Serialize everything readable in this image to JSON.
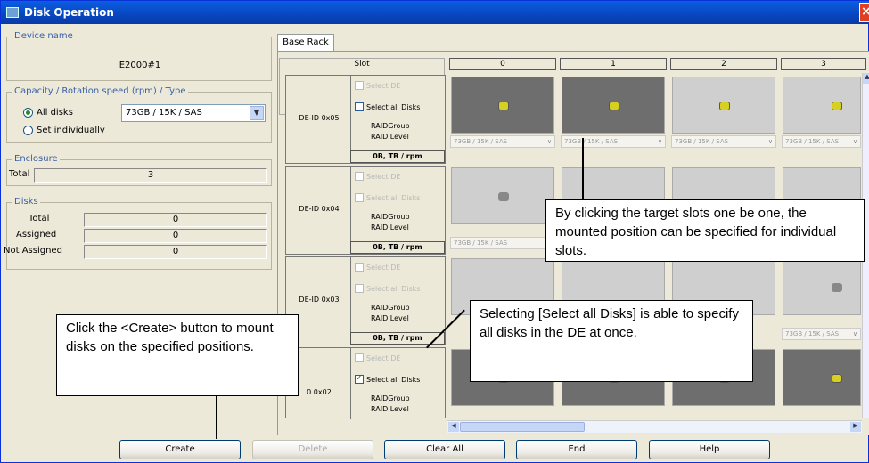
{
  "window": {
    "title": "Disk Operation"
  },
  "left": {
    "device_name": {
      "legend": "Device name",
      "value": "E2000#1"
    },
    "capacity": {
      "legend": "Capacity / Rotation speed (rpm) / Type",
      "all_disks": "All disks",
      "set_individually": "Set individually",
      "selected_value": "73GB / 15K / SAS"
    },
    "enclosure": {
      "legend": "Enclosure",
      "total_label": "Total",
      "total_value": "3"
    },
    "disks": {
      "legend": "Disks",
      "total_label": "Total",
      "total_value": "0",
      "assigned_label": "Assigned",
      "assigned_value": "0",
      "not_assigned_label": "Not Assigned",
      "not_assigned_value": "0"
    }
  },
  "tab": {
    "label": "Base Rack"
  },
  "grid": {
    "slot_header": "Slot",
    "columns": [
      "0",
      "1",
      "2",
      "3"
    ],
    "select_de": "Select DE",
    "select_all_disks": "Select all Disks",
    "raid_group": "RAIDGroup",
    "raid_level": "RAID Level",
    "capacity_line": "0B, TB / rpm",
    "size_value": "73GB / 15K / SAS",
    "rows": [
      {
        "label": "DE-ID 0x05"
      },
      {
        "label": "DE-ID 0x04"
      },
      {
        "label": "DE-ID 0x03"
      },
      {
        "label": "0 0x02"
      }
    ]
  },
  "buttons": {
    "create": "Create",
    "delete": "Delete",
    "clear_all": "Clear All",
    "end": "End",
    "help": "Help"
  },
  "callouts": {
    "slots": "By clicking the target slots one be one, the mounted position can be specified for individual slots.",
    "select_all": "Selecting [Select all Disks] is able to specify all disks in the DE at once.",
    "create": "Click the <Create> button to mount disks on the specified positions."
  }
}
